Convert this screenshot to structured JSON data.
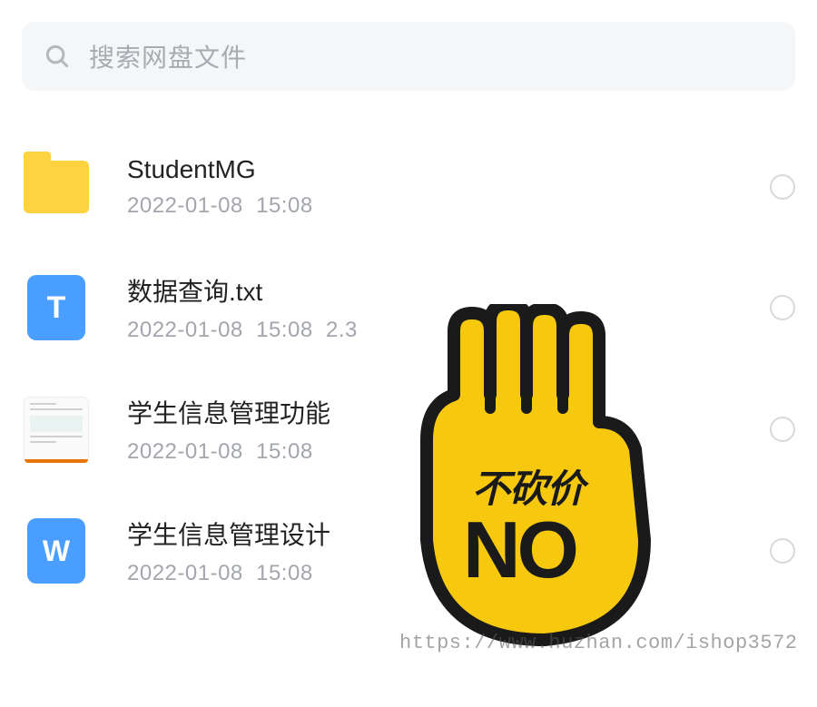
{
  "search": {
    "placeholder": "搜索网盘文件"
  },
  "files": [
    {
      "type": "folder",
      "name": "StudentMG",
      "date": "2022-01-08",
      "time": "15:08",
      "size": ""
    },
    {
      "type": "txt",
      "name": "数据查询.txt",
      "date": "2022-01-08",
      "time": "15:08",
      "size": "2.3"
    },
    {
      "type": "doc_thumb",
      "name": "学生信息管理功能",
      "date": "2022-01-08",
      "time": "15:08",
      "size": ""
    },
    {
      "type": "word",
      "name": "学生信息管理设计",
      "date": "2022-01-08",
      "time": "15:08",
      "size": ""
    }
  ],
  "sticker": {
    "cn": "不砍价",
    "en": "NO",
    "bg_color": "#f6c90e",
    "outline_color": "#1a1a1a"
  },
  "watermark": "https://www.huzhan.com/ishop3572"
}
